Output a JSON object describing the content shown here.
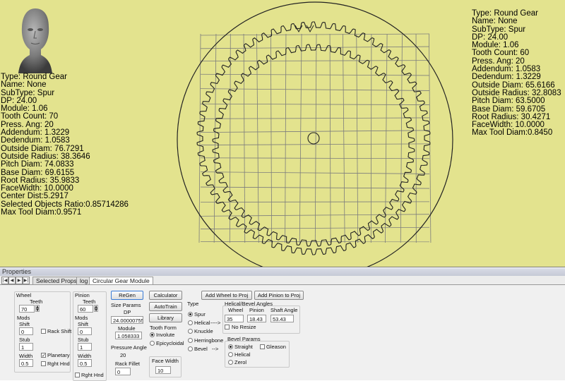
{
  "viewport": {
    "left_info": [
      "Type: Round Gear",
      "Name: None",
      "SubType: Spur",
      "DP: 24.00",
      "Module: 1.06",
      "Tooth Count: 70",
      "Press. Ang: 20",
      "Addendum: 1.3229",
      "Dedendum: 1.0583",
      "Outside Diam: 76.7291",
      "Outside Radius: 38.3646",
      "Pitch Diam: 74.0833",
      "Base Diam: 69.6155",
      "Root Radius: 35.9833",
      "FaceWidth: 10.0000",
      "Center Dist:5.2917",
      "Selected Objects Ratio:0.85714286",
      "Max Tool Diam:0.9571"
    ],
    "right_info": [
      "Type: Round Gear",
      "Name: None",
      "SubType: Spur",
      "DP: 24.00",
      "Module: 1.06",
      "Tooth Count: 60",
      "Press. Ang: 20",
      "Addendum: 1.0583",
      "Dedendum: 1.3229",
      "Outside Diam: 65.6166",
      "Outside Radius: 32.8083",
      "Pitch Diam: 63.5000",
      "Base Diam: 59.6705",
      "Root Radius: 30.4271",
      "FaceWidth: 10.0000",
      "Max Tool Diam:0.8450"
    ],
    "wheel_teeth": 70,
    "pinion_teeth": 60,
    "bg_color": "#e3e38e"
  },
  "properties": {
    "title": "Properties",
    "tabs": [
      "Selected Props",
      "log",
      "Circular Gear Module"
    ],
    "wheel": {
      "title": "Wheel",
      "teeth_label": "Teeth",
      "teeth": "70",
      "mods_label": "Mods",
      "shift_label": "Shift",
      "shift": "0",
      "rack_shift_label": "Rack Shift",
      "stub_label": "Stub",
      "stub": "1",
      "planetary_label": "Planetary",
      "width_label": "Width",
      "width": "0.5",
      "rght_hnd_label": "Rght Hnd"
    },
    "pinion": {
      "title": "Pinion",
      "teeth_label": "Teeth",
      "teeth": "60",
      "mods_label": "Mods",
      "shift_label": "Shift",
      "shift": "0",
      "stub_label": "Stub",
      "stub": "1",
      "width_label": "Width",
      "width": "0.5",
      "rght_hnd_label": "Rght Hnd"
    },
    "regen_label": "ReGen",
    "size_params_label": "Size Params",
    "dp_label": "DP",
    "dp": "24.00000755",
    "module_label": "Module",
    "module": "1.058333",
    "pressure_angle_label": "Pressure Angle",
    "pressure_angle": "20",
    "rack_fillet_label": "Rack Fillet",
    "rack_fillet": "0",
    "calculator_label": "Calculator",
    "autotrain_label": "AutoTrain",
    "library_label": "Library",
    "tooth_form_label": "Tooth Form",
    "involute_label": "Involute",
    "epicycloidal_label": "Epicycloidal",
    "face_width_label": "Face Width",
    "face_width": "10",
    "add_wheel_label": "Add Wheel to Proj",
    "add_pinion_label": "Add Pinion to Proj",
    "type_label": "Type",
    "type_options": [
      "Spur",
      "Helical",
      "Knuckle",
      "Herringbone",
      "Bevel"
    ],
    "helical_arrow": "---->",
    "bevel_arrow": "-->",
    "helical_bevel_label": "Helical/Bevel Angles",
    "hb_wheel_label": "Wheel",
    "hb_wheel": "35",
    "hb_pinion_label": "Pinion",
    "hb_pinion": "18.43",
    "shaft_angle_label": "Shaft Angle",
    "shaft_angle": "53.43",
    "no_resize_label": "No Resize",
    "bevel_params_label": "Bevel Params",
    "bevel_options": [
      "Straight",
      "Helical",
      "Zerol"
    ],
    "gleason_label": "Gleason"
  }
}
